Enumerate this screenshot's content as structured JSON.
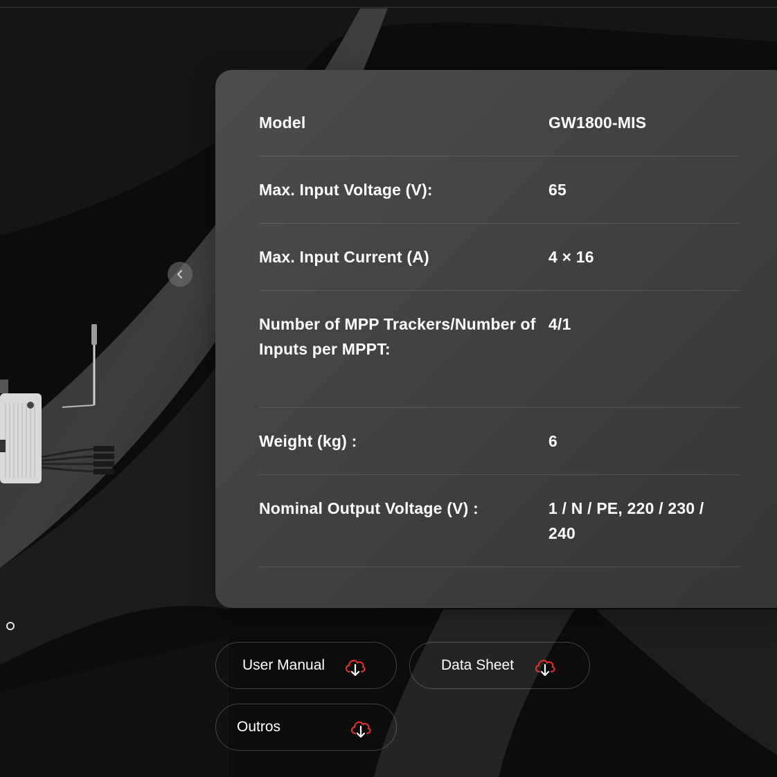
{
  "carousel": {
    "prev_icon": "chevron-left-icon",
    "dot_icon": "carousel-dot-icon"
  },
  "specs": {
    "rows": [
      {
        "label": "Model",
        "value": "GW1800-MIS"
      },
      {
        "label": "Max. Input Voltage (V):",
        "value": "65"
      },
      {
        "label": "Max. Input Current (A)",
        "value": "4 × 16"
      },
      {
        "label": "Number of MPP Trackers/Number of Inputs per MPPT:",
        "value": "4/1"
      },
      {
        "label": "Weight (kg) :",
        "value": "6"
      },
      {
        "label": "Nominal Output Voltage (V) :",
        "value": "1 / N / PE, 220 / 230 / 240"
      }
    ]
  },
  "downloads": {
    "user_manual": "User Manual",
    "data_sheet": "Data Sheet",
    "others": "Outros",
    "icon": "cloud-download-icon",
    "icon_color": "#e0322d"
  },
  "colors": {
    "background": "#0c0c0c",
    "card": "#444444",
    "accent": "#e0322d"
  }
}
